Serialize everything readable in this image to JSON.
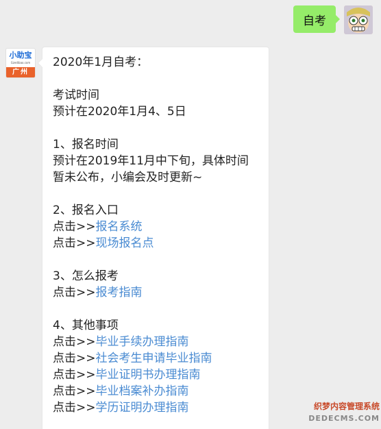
{
  "outgoing": {
    "text": "自考"
  },
  "bot": {
    "logo_name": "小助宝",
    "logo_url": "Gzedibao.com",
    "logo_city": "广州"
  },
  "message": {
    "title": "2020年1月自考：",
    "sections": {
      "exam_time": {
        "heading": "考试时间",
        "detail": "预计在2020年1月4、5日"
      },
      "signup_time": {
        "heading": "1、报名时间",
        "detail_line1": "预计在2019年11月中下旬，具体时间",
        "detail_line2": "暂未公布，小编会及时更新~"
      },
      "signup_entry": {
        "heading": "2、报名入口",
        "links": [
          {
            "prefix": "点击>>",
            "label": "报名系统"
          },
          {
            "prefix": "点击>>",
            "label": "现场报名点"
          }
        ]
      },
      "how_to": {
        "heading": "3、怎么报考",
        "links": [
          {
            "prefix": "点击>>",
            "label": "报考指南"
          }
        ]
      },
      "other": {
        "heading": "4、其他事项",
        "links": [
          {
            "prefix": "点击>>",
            "label": "毕业手续办理指南"
          },
          {
            "prefix": "点击>>",
            "label": "社会考生申请毕业指南"
          },
          {
            "prefix": "点击>>",
            "label": "毕业证明书办理指南"
          },
          {
            "prefix": "点击>>",
            "label": "毕业档案补办指南"
          },
          {
            "prefix": "点击>>",
            "label": "学历证明办理指南"
          }
        ]
      }
    }
  },
  "watermark": {
    "line1": "织梦内容管理系统",
    "line2": "DEDECMS.COM"
  },
  "colors": {
    "background": "#ededed",
    "outgoing_bubble": "#95ec69",
    "link": "#4a8bd2"
  }
}
